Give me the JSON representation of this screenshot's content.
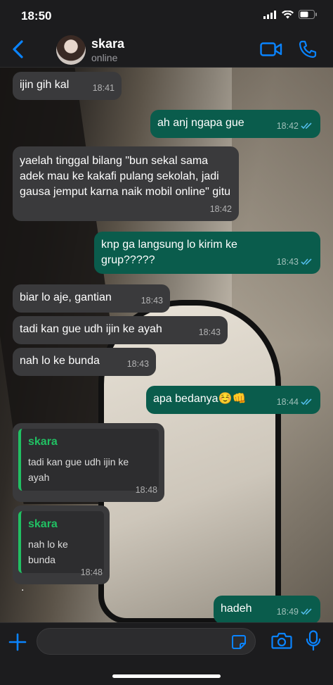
{
  "status_bar": {
    "time": "18:50"
  },
  "header": {
    "name": "skara",
    "status": "online"
  },
  "messages": [
    {
      "text": "ijin gih kal",
      "time": "18:41"
    },
    {
      "text": "ah anj ngapa gue",
      "time": "18:42"
    },
    {
      "text": "yaelah tinggal bilang \"bun sekal sama adek mau ke kakafi pulang sekolah, jadi gausa jemput karna naik mobil online\" gitu",
      "time": "18:42"
    },
    {
      "text": "knp ga langsung lo kirim ke grup?????",
      "time": "18:43"
    },
    {
      "text": "biar lo aje, gantian",
      "time": "18:43"
    },
    {
      "text": "tadi kan gue udh ijin ke ayah",
      "time": "18:43"
    },
    {
      "text": "nah lo ke bunda",
      "time": "18:43"
    },
    {
      "text": "apa bedanya☺️👊",
      "time": "18:44"
    },
    {
      "quote_name": "skara",
      "quote_text": "tadi kan gue udh ijin ke ayah",
      "text": ".",
      "time": "18:48"
    },
    {
      "quote_name": "skara",
      "quote_text": "nah lo ke bunda",
      "text": ".",
      "time": "18:48"
    },
    {
      "text": "hadeh",
      "time": "18:49"
    }
  ],
  "icons": {
    "back": "chevron-left-icon",
    "video": "video-call-icon",
    "call": "phone-icon",
    "plus": "plus-icon",
    "sticker": "sticker-icon",
    "camera": "camera-icon",
    "mic": "microphone-icon"
  },
  "colors": {
    "accent": "#0a84ff",
    "outgoing": "#0a5c4c",
    "incoming": "#3a3a3c",
    "quote": "#21c063",
    "ticks": "#53bdeb"
  }
}
